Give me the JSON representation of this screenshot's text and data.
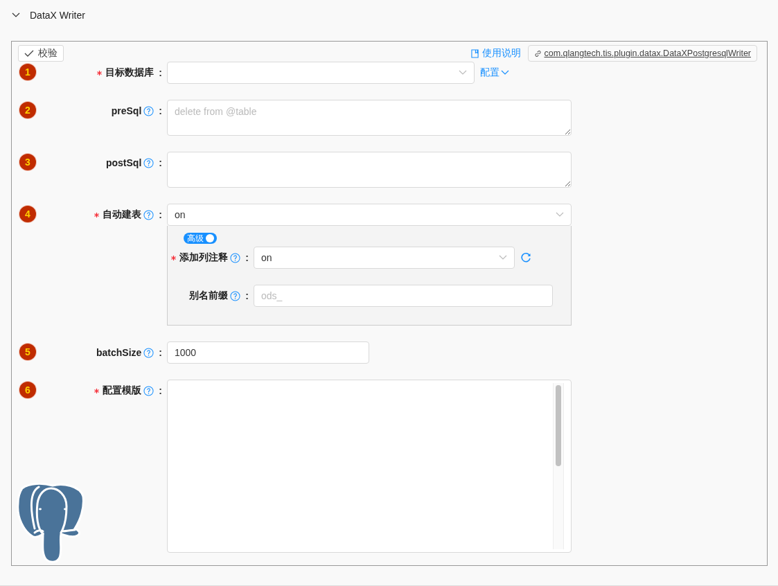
{
  "section": {
    "title": "DataX Writer",
    "expanded": true
  },
  "toolbar": {
    "validate_button": "校验",
    "help_link": "使用说明",
    "plugin_link": "com.qlangtech.tis.plugin.datax.DataXPostgresqlWriter"
  },
  "fields": [
    {
      "index": "1",
      "label": "目标数据库",
      "colon": ":",
      "required": true,
      "help": false,
      "kind": "select",
      "action": "配置"
    },
    {
      "index": "2",
      "label": "preSql",
      "colon": ":",
      "required": false,
      "help": true,
      "kind": "textarea",
      "placeholder": "delete from @table"
    },
    {
      "index": "3",
      "label": "postSql",
      "colon": ":",
      "required": false,
      "help": true,
      "kind": "textarea"
    },
    {
      "index": "4",
      "label": "自动建表",
      "colon": ":",
      "required": true,
      "help": true,
      "kind": "select",
      "value": "on",
      "group": {
        "toggle": {
          "label": "高级",
          "on": true
        },
        "fields": [
          {
            "label": "添加列注释",
            "colon": ":",
            "required": true,
            "help": true,
            "kind": "select",
            "value": "on",
            "refresh": true
          },
          {
            "label": "别名前缀",
            "colon": ":",
            "required": false,
            "help": true,
            "kind": "input",
            "placeholder": "ods_"
          }
        ]
      }
    },
    {
      "index": "5",
      "label": "batchSize",
      "colon": ":",
      "required": false,
      "help": true,
      "kind": "input",
      "value": "1000"
    },
    {
      "index": "6",
      "label": "配置模版",
      "colon": ":",
      "required": true,
      "help": true,
      "kind": "code-editor"
    }
  ]
}
